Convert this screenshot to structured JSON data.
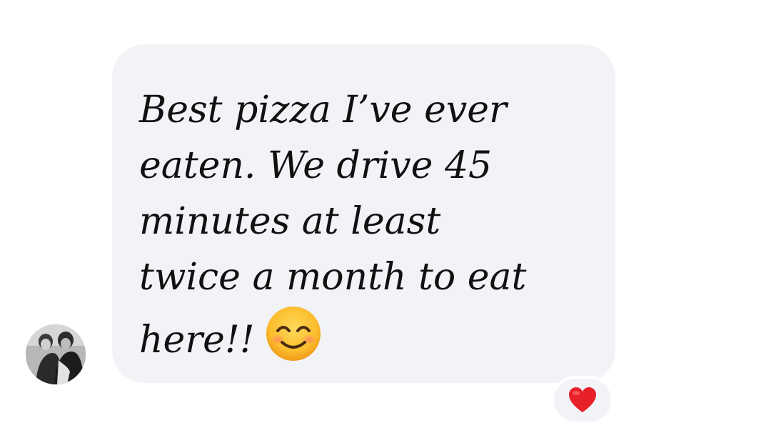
{
  "message": {
    "lines": [
      "Best pizza I’ve ever",
      "eaten. We drive 45",
      "minutes at least",
      "twice a month to eat",
      "here!!"
    ],
    "emoji_icon": "smiling-face-with-smiling-eyes-icon"
  },
  "reaction": {
    "icon": "red-heart-icon",
    "color": "#e8202a"
  },
  "colors": {
    "bubble": "#f2f3f7",
    "text": "#111111",
    "background": "#ffffff"
  }
}
